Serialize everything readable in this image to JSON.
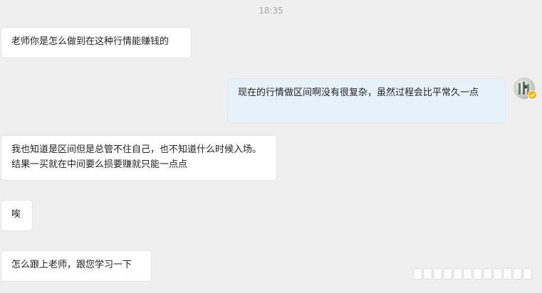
{
  "chat": {
    "timestamp": "18:35",
    "messages": [
      {
        "direction": "in",
        "text": "老师你是怎么做到在这种行情能赚钱的"
      },
      {
        "direction": "out",
        "text": "现在的行情做区间啊没有很复杂，虽然过程会比平常久一点"
      },
      {
        "direction": "in",
        "text": "我也知道是区间但是总管不住自己，也不知道什么时候入场。结果一买就在中间要么损要赚就只能一点点"
      },
      {
        "direction": "in",
        "text": "唉"
      },
      {
        "direction": "in",
        "text": "怎么跟上老师，跟您学习一下"
      }
    ]
  },
  "colors": {
    "background": "#efefef",
    "incoming_bubble": "#ffffff",
    "outgoing_bubble": "#e8f2fb",
    "badge": "#f5b20f"
  },
  "icons": {
    "avatar": "user-avatar",
    "badge": "verified-badge-icon",
    "watermark": "weibo-watermark"
  }
}
